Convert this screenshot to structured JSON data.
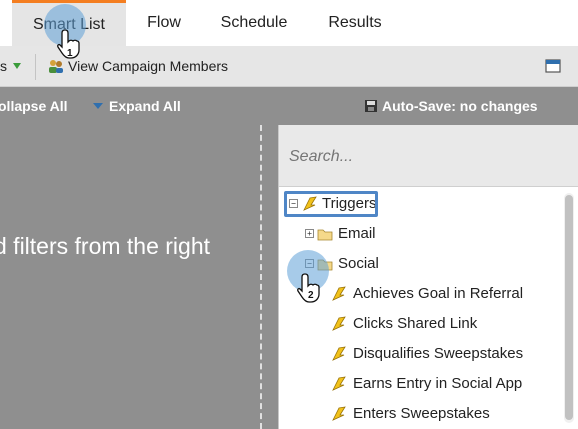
{
  "tabs": [
    {
      "label": "Smart List",
      "active": true
    },
    {
      "label": "Flow",
      "active": false
    },
    {
      "label": "Schedule",
      "active": false
    },
    {
      "label": "Results",
      "active": false
    }
  ],
  "toolbar": {
    "cut_text": "s",
    "view_members_label": "View Campaign Members"
  },
  "actions": {
    "collapse_label": "ollapse All",
    "expand_label": "Expand All",
    "autosave_label": "Auto-Save: no changes"
  },
  "canvas": {
    "message": "d filters from the right"
  },
  "search": {
    "placeholder": "Search..."
  },
  "tree": {
    "root": "Triggers",
    "folders": [
      "Email",
      "Social"
    ],
    "social_items": [
      "Achieves Goal in Referral",
      "Clicks Shared Link",
      "Disqualifies Sweepstakes",
      "Earns Entry in Social App",
      "Enters Sweepstakes"
    ]
  },
  "callouts": [
    "1",
    "2"
  ],
  "colors": {
    "active_tab_border": "#f47e20",
    "highlight_border": "#4f86c6",
    "callout": "#5fa0d7"
  }
}
